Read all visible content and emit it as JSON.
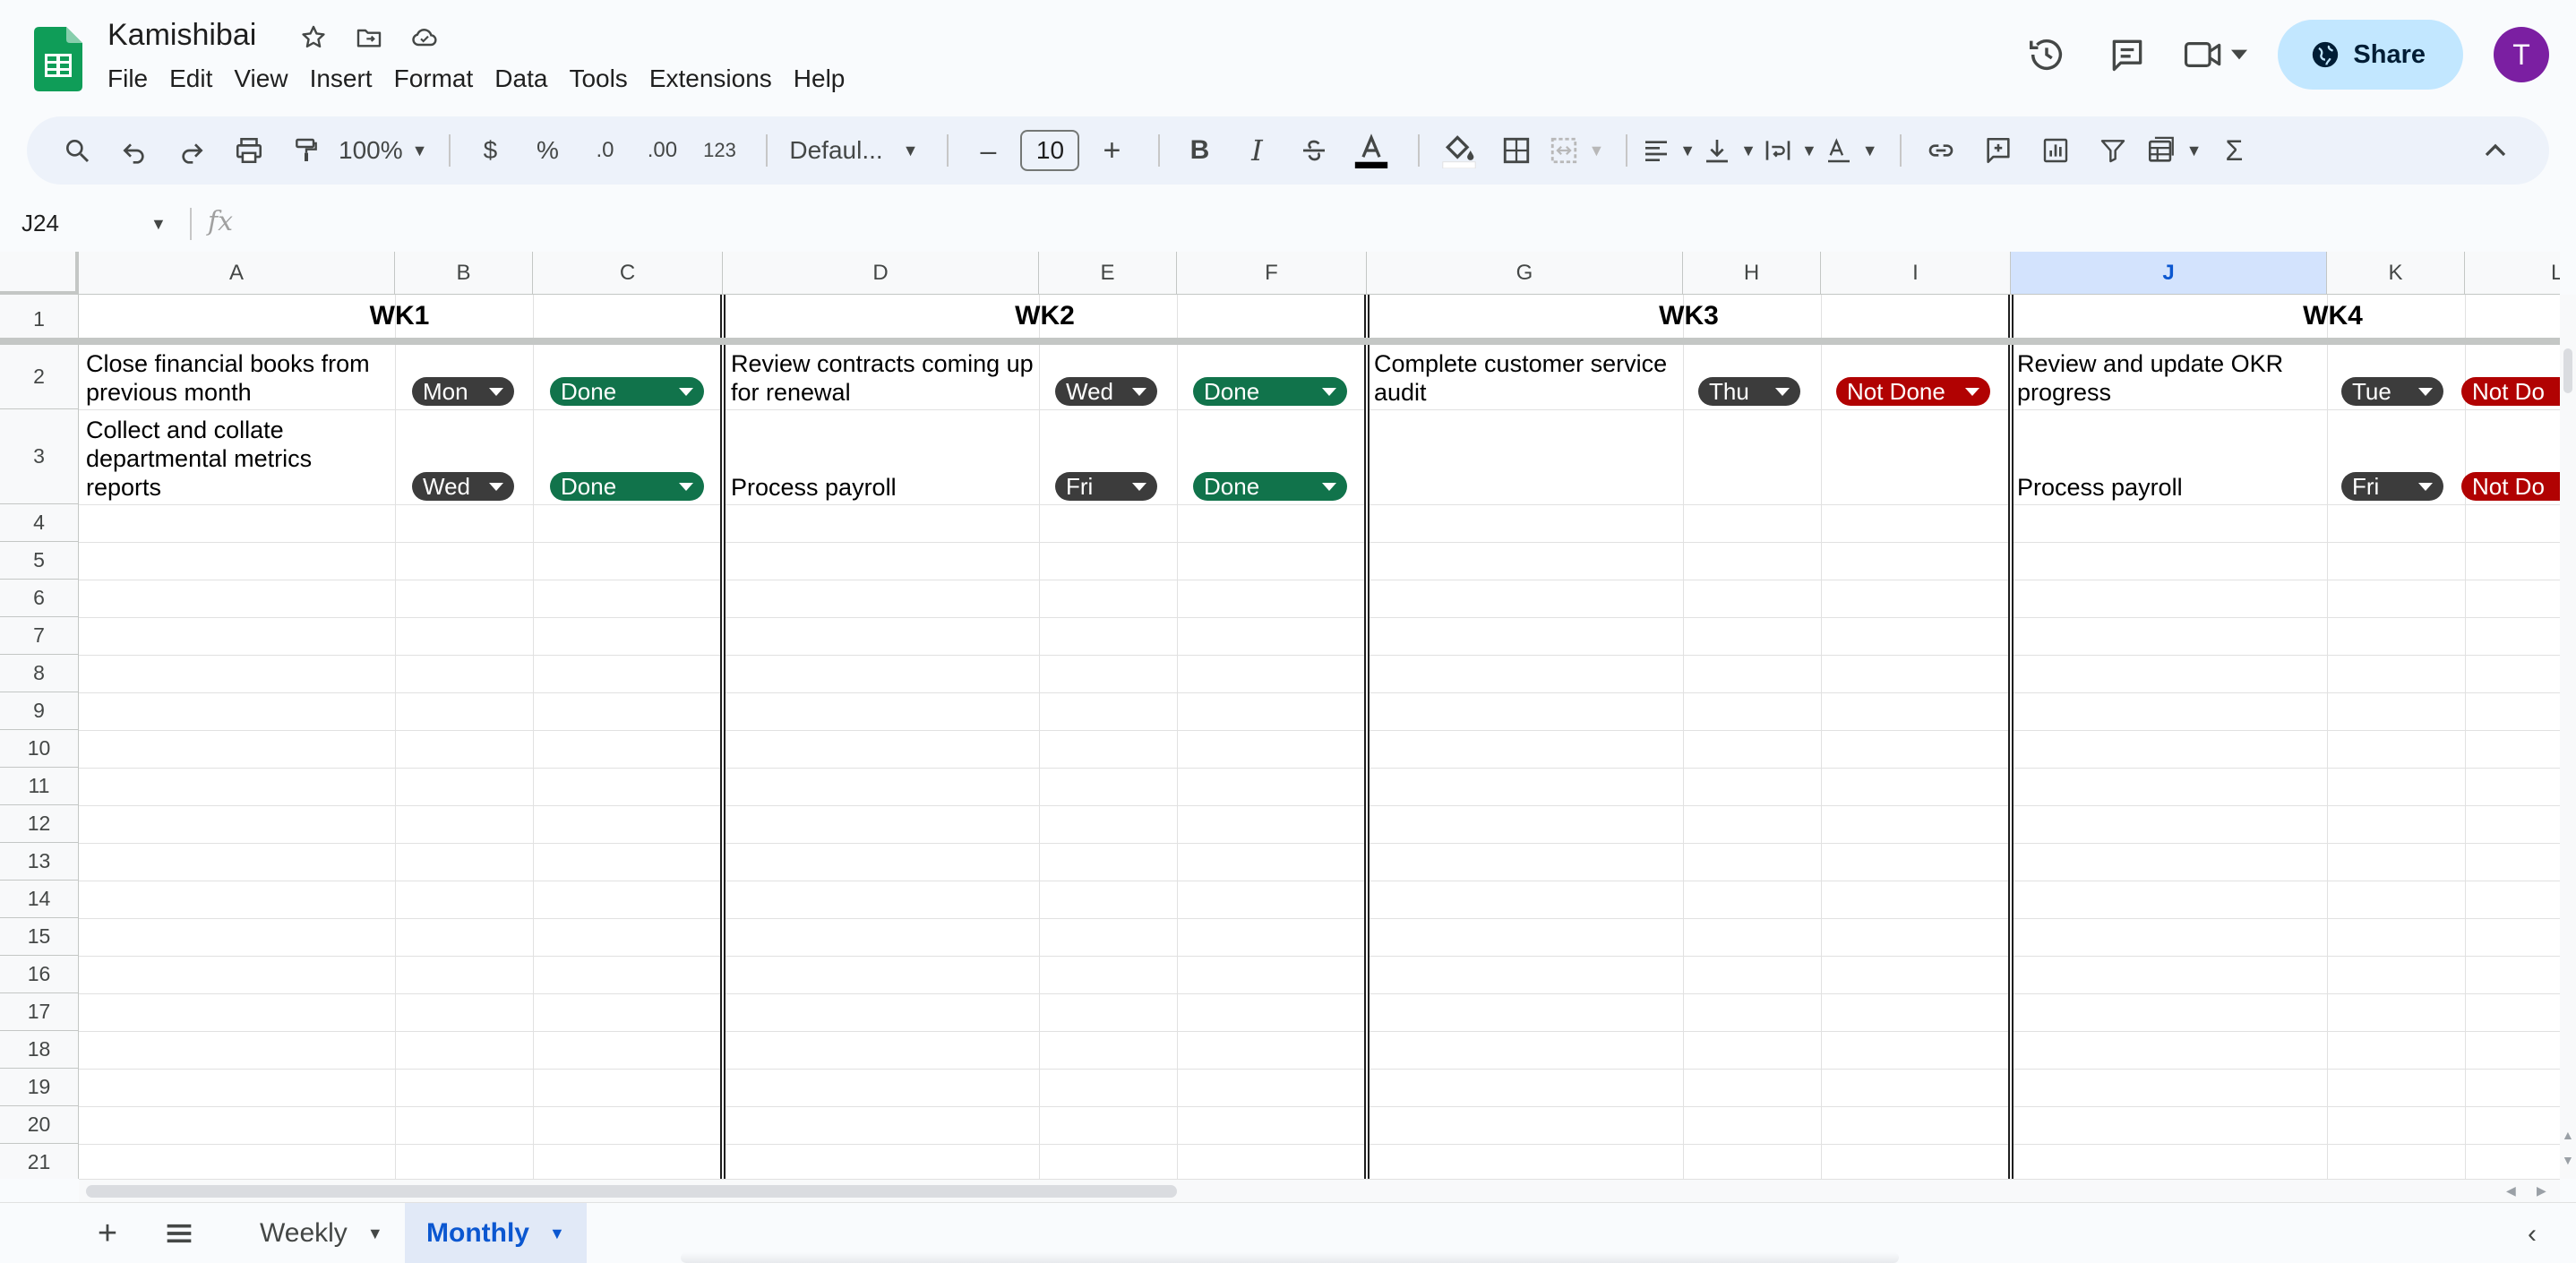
{
  "app": {
    "title": "Kamishibai",
    "menu": [
      "File",
      "Edit",
      "View",
      "Insert",
      "Format",
      "Data",
      "Tools",
      "Extensions",
      "Help"
    ],
    "share_label": "Share",
    "avatar_initial": "T",
    "brand_color": "#0f9d58"
  },
  "toolbar": {
    "zoom": "100%",
    "currency": "$",
    "percent": "%",
    "decrease_decimal": ".0",
    "increase_decimal": ".00",
    "number_format": "123",
    "font": "Defaul...",
    "font_size": "10",
    "minus": "–",
    "plus": "+",
    "bold": "B",
    "italic": "I",
    "sum": "Σ"
  },
  "formula_bar": {
    "cell_ref": "J24",
    "fx": "fx"
  },
  "grid": {
    "columns": [
      "A",
      "B",
      "C",
      "D",
      "E",
      "F",
      "G",
      "H",
      "I",
      "J",
      "K",
      "L"
    ],
    "selected_column": "J",
    "rows": [
      "1",
      "2",
      "3",
      "4",
      "5",
      "6",
      "7",
      "8",
      "9",
      "10",
      "11",
      "12",
      "13",
      "14",
      "15",
      "16",
      "17",
      "18",
      "19",
      "20",
      "21"
    ],
    "weeks": [
      "WK1",
      "WK2",
      "WK3",
      "WK4"
    ],
    "tasks": {
      "wk1_row2": {
        "task": "Close financial books from previous month",
        "day": "Mon",
        "status": "Done"
      },
      "wk1_row3": {
        "task": "Collect and collate departmental metrics reports",
        "day": "Wed",
        "status": "Done"
      },
      "wk2_row2": {
        "task": "Review contracts coming up for renewal",
        "day": "Wed",
        "status": "Done"
      },
      "wk2_row3": {
        "task": "Process payroll",
        "day": "Fri",
        "status": "Done"
      },
      "wk3_row2": {
        "task": "Complete customer service audit",
        "day": "Thu",
        "status": "Not Done"
      },
      "wk4_row2": {
        "task": "Review and update OKR progress",
        "day": "Tue",
        "status": "Not Do"
      },
      "wk4_row3": {
        "task": "Process payroll",
        "day": "Fri",
        "status": "Not Do"
      }
    },
    "status_colors": {
      "done": "#11734b",
      "not_done": "#b10202",
      "day": "#3c3c3c"
    }
  },
  "sheets": {
    "tabs": [
      "Weekly",
      "Monthly"
    ],
    "active": "Monthly",
    "add": "+"
  }
}
